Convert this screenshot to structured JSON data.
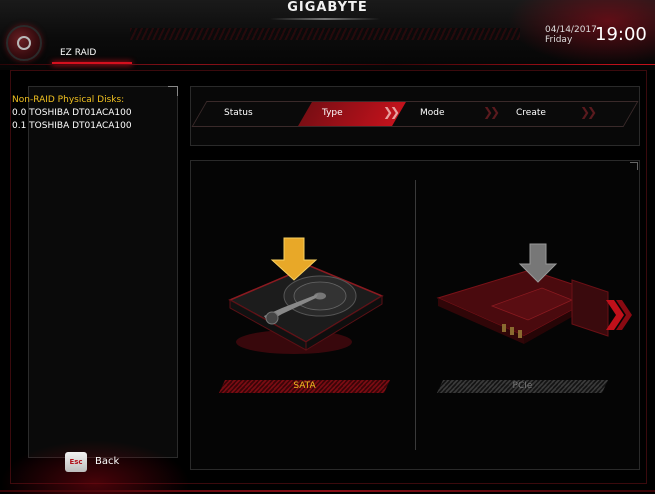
{
  "header": {
    "brand": "GIGABYTE",
    "tab": "EZ RAID",
    "date": "04/14/2017",
    "day": "Friday",
    "time": "19:00"
  },
  "left_panel": {
    "title": "Non-RAID Physical Disks:",
    "disks": [
      "0.0  TOSHIBA DT01ACA100",
      "0.1  TOSHIBA DT01ACA100"
    ]
  },
  "steps": {
    "items": [
      "Status",
      "Type",
      "Mode",
      "Create"
    ],
    "active": "Type"
  },
  "options": {
    "sata_label": "SATA",
    "pcie_label": "PCIe"
  },
  "footer": {
    "esc_key": "Esc",
    "back_label": "Back"
  },
  "colors": {
    "accent_red": "#d4101e",
    "highlight_yellow": "#f0c020",
    "inactive_gray": "#777777"
  },
  "icons": [
    "hdd-icon",
    "pcie-card-icon",
    "download-arrow-icon",
    "next-chevron-icon",
    "settings-logo-icon"
  ]
}
